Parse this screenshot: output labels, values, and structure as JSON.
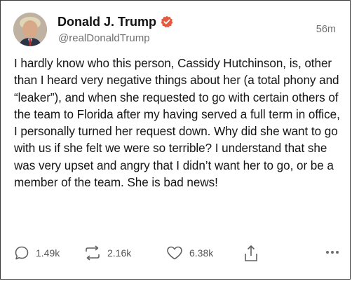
{
  "post": {
    "display_name": "Donald J. Trump",
    "handle": "@realDonaldTrump",
    "time": "56m",
    "text": "I hardly know who this person, Cassidy Hutchinson, is, other than I heard very negative things about her (a total phony and “leaker”), and when she requested to go with certain others of the team to Florida after my having served a full term in office, I personally turned her request down. Why did she want to go with us if she felt we were so terrible? I understand that she was very upset and angry that I didn’t want her to go, or be a member of the team. She is bad news!"
  },
  "actions": {
    "replies": "1.49k",
    "retruths": "2.16k",
    "likes": "6.38k"
  },
  "icons": {
    "verified": "verified-badge-icon",
    "reply": "reply-bubble-icon",
    "retruth": "retruth-arrows-icon",
    "like": "heart-icon",
    "share": "share-upload-icon",
    "more": "more-dots-icon"
  },
  "colors": {
    "verified": "#e8583f",
    "text": "#151515",
    "muted": "#707070"
  }
}
